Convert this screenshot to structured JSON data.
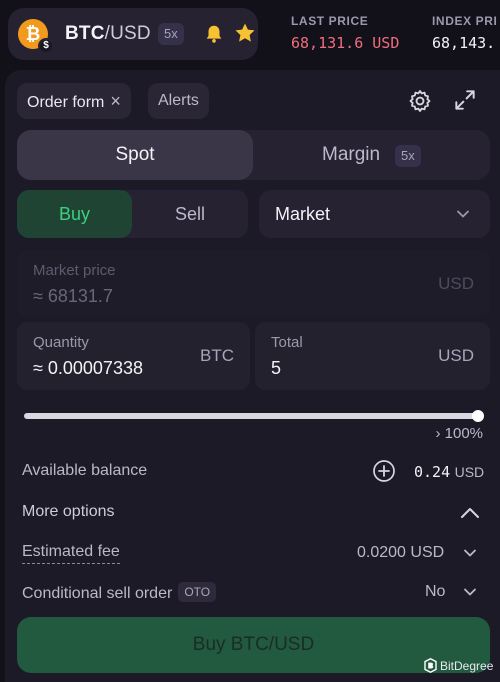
{
  "pair": {
    "base": "BTC",
    "quote": "/USD",
    "leverage": "5x",
    "coin_glyph": "₿",
    "quote_badge": "$"
  },
  "stats": {
    "last_price_label": "LAST PRICE",
    "last_price_value": "68,131.6 USD",
    "index_price_label": "INDEX PRI",
    "index_price_value": "68,143."
  },
  "panel": {
    "tabs": {
      "order_form": "Order form",
      "close": "×",
      "alerts": "Alerts"
    },
    "segment": {
      "spot": "Spot",
      "margin": "Margin",
      "margin_leverage": "5x"
    },
    "side": {
      "buy": "Buy",
      "sell": "Sell"
    },
    "order_type": "Market",
    "market_price": {
      "label": "Market price",
      "value": "≈ 68131.7",
      "unit": "USD"
    },
    "quantity": {
      "label": "Quantity",
      "value": "≈ 0.00007338",
      "unit": "BTC"
    },
    "total": {
      "label": "Total",
      "value": "5",
      "unit": "USD"
    },
    "slider": {
      "percent": 100,
      "text": "› 100%"
    },
    "available_balance": {
      "label": "Available balance",
      "value": "0.24",
      "unit": "USD"
    },
    "more_options": "More options",
    "estimated_fee": {
      "label": "Estimated fee",
      "value": "0.0200 USD"
    },
    "conditional_sell": {
      "label": "Conditional sell order",
      "badge": "OTO",
      "value": "No"
    },
    "submit": "Buy BTC/USD"
  },
  "watermark": "BitDegree",
  "colors": {
    "buy": "#3ecf7f",
    "last_price": "#ef6e7e",
    "btc": "#f29a1d",
    "star": "#f6c233"
  }
}
